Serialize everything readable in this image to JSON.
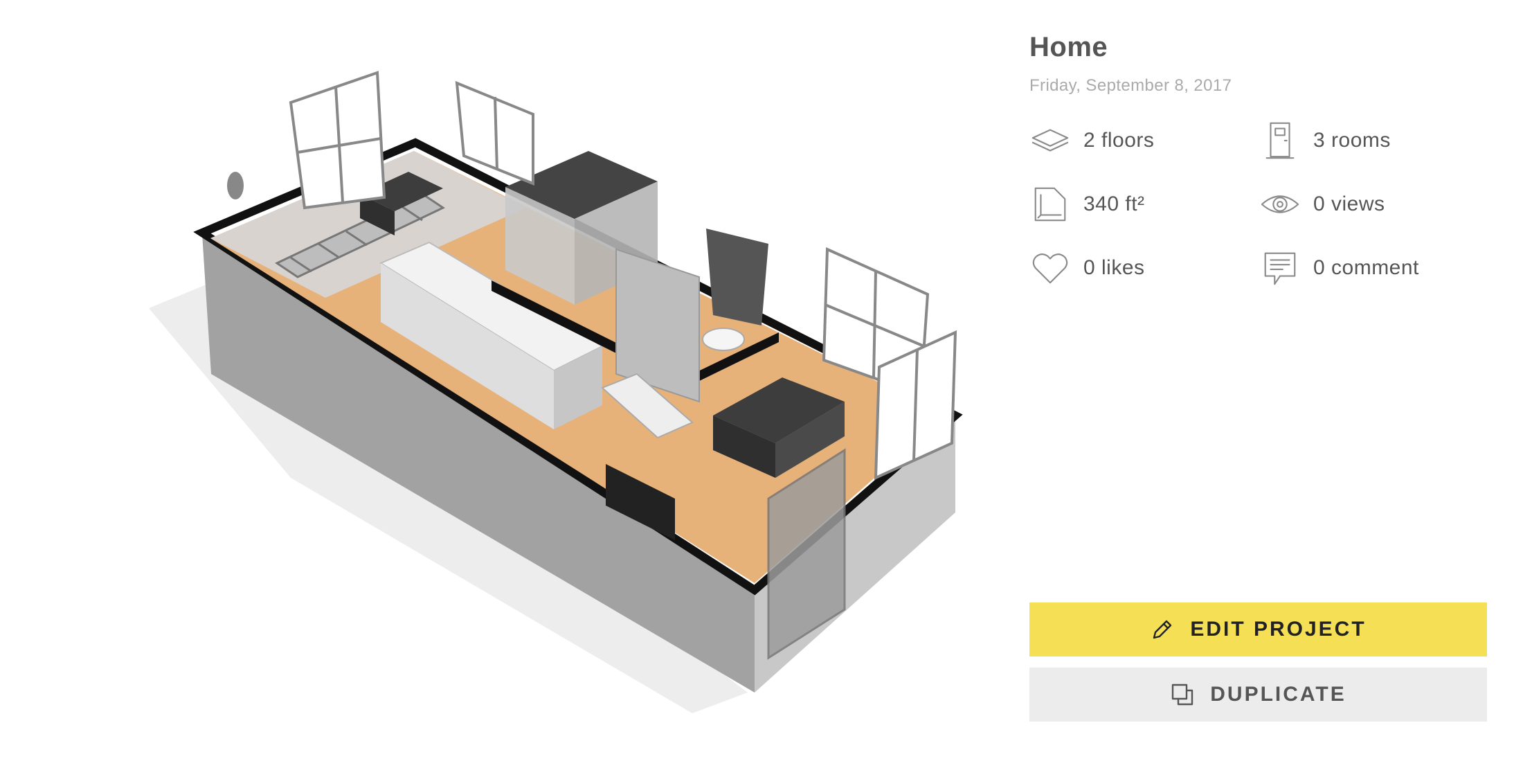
{
  "project": {
    "title": "Home",
    "date": "Friday, September 8, 2017"
  },
  "stats": {
    "floors": {
      "label": "2 floors",
      "icon": "layers-icon"
    },
    "rooms": {
      "label": "3 rooms",
      "icon": "door-icon"
    },
    "area": {
      "label": "340 ft²",
      "icon": "area-icon"
    },
    "views": {
      "label": "0 views",
      "icon": "eye-icon"
    },
    "likes": {
      "label": "0 likes",
      "icon": "heart-icon"
    },
    "comments": {
      "label": "0 comment",
      "icon": "comment-icon"
    }
  },
  "actions": {
    "edit_label": "EDIT PROJECT",
    "edit_icon": "pencil-icon",
    "duplicate_label": "DUPLICATE",
    "duplicate_icon": "duplicate-icon"
  },
  "colors": {
    "edit_button_bg": "#f5df55",
    "duplicate_button_bg": "#ececec",
    "floor": "#e8b47a",
    "wall": "#9b9b9b"
  }
}
